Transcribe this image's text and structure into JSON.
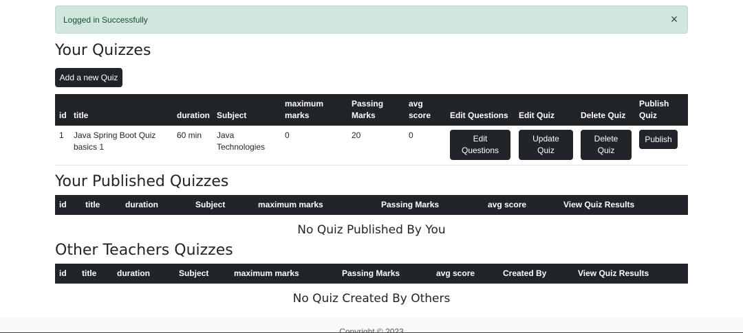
{
  "alert": {
    "message": "Logged in Successfully",
    "close_symbol": "×"
  },
  "your_quizzes": {
    "heading": "Your Quizzes",
    "add_button": "Add a new Quiz",
    "columns": [
      "id",
      "title",
      "duration",
      "Subject",
      "maximum marks",
      "Passing Marks",
      "avg score",
      "Edit Questions",
      "Edit Quiz",
      "Delete Quiz",
      "Publish Quiz"
    ],
    "rows": [
      {
        "id": "1",
        "title": "Java Spring Boot Quiz basics 1",
        "duration": "60 min",
        "subject": "Java Technologies",
        "maximum_marks": "0",
        "passing_marks": "20",
        "avg_score": "0",
        "edit_questions": "Edit Questions",
        "edit_quiz": "Update Quiz",
        "delete_quiz": "Delete Quiz",
        "publish": "Publish"
      }
    ]
  },
  "published_quizzes": {
    "heading": "Your Published Quizzes",
    "columns": [
      "id",
      "title",
      "duration",
      "Subject",
      "maximum marks",
      "Passing Marks",
      "avg score",
      "View Quiz Results"
    ],
    "empty": "No Quiz Published By You"
  },
  "other_quizzes": {
    "heading": "Other Teachers Quizzes",
    "columns": [
      "id",
      "title",
      "duration",
      "Subject",
      "maximum marks",
      "Passing Marks",
      "avg score",
      "Created By",
      "View Quiz Results"
    ],
    "empty": "No Quiz Created By Others"
  },
  "footer": {
    "text": "Copyright © 2023"
  }
}
